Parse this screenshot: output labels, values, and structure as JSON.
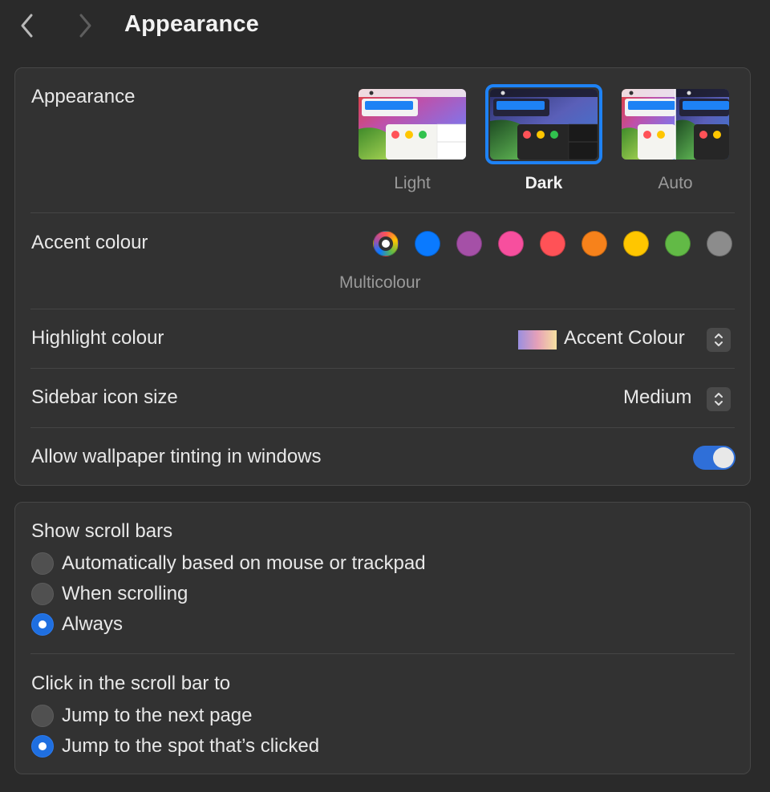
{
  "toolbar": {
    "title": "Appearance",
    "back_icon": "chevron-left-icon",
    "forward_icon": "chevron-right-icon"
  },
  "appearance": {
    "label": "Appearance",
    "options": [
      {
        "label": "Light",
        "selected": false
      },
      {
        "label": "Dark",
        "selected": true
      },
      {
        "label": "Auto",
        "selected": false
      }
    ]
  },
  "accent": {
    "label": "Accent colour",
    "selected_label": "Multicolour",
    "colors": [
      {
        "name": "multicolour",
        "hex": "multicolor"
      },
      {
        "name": "blue",
        "hex": "#0a7aff"
      },
      {
        "name": "purple",
        "hex": "#a550a7"
      },
      {
        "name": "pink",
        "hex": "#f74f9e"
      },
      {
        "name": "red",
        "hex": "#ff5257"
      },
      {
        "name": "orange",
        "hex": "#f7821b"
      },
      {
        "name": "yellow",
        "hex": "#ffc600"
      },
      {
        "name": "green",
        "hex": "#62ba46"
      },
      {
        "name": "graphite",
        "hex": "#8c8c8c"
      }
    ]
  },
  "highlight": {
    "label": "Highlight colour",
    "value": "Accent Colour"
  },
  "sidebar_icon": {
    "label": "Sidebar icon size",
    "value": "Medium"
  },
  "wallpaper_tinting": {
    "label": "Allow wallpaper tinting in windows",
    "enabled": true
  },
  "scroll_bars": {
    "label": "Show scroll bars",
    "options": [
      {
        "label": "Automatically based on mouse or trackpad",
        "selected": false
      },
      {
        "label": "When scrolling",
        "selected": false
      },
      {
        "label": "Always",
        "selected": true
      }
    ]
  },
  "click_scroll": {
    "label": "Click in the scroll bar to",
    "options": [
      {
        "label": "Jump to the next page",
        "selected": false
      },
      {
        "label": "Jump to the spot that’s clicked",
        "selected": true
      }
    ]
  },
  "colors": {
    "accent": "#1e82f5",
    "background": "#2a2a2a",
    "card": "#323232"
  }
}
